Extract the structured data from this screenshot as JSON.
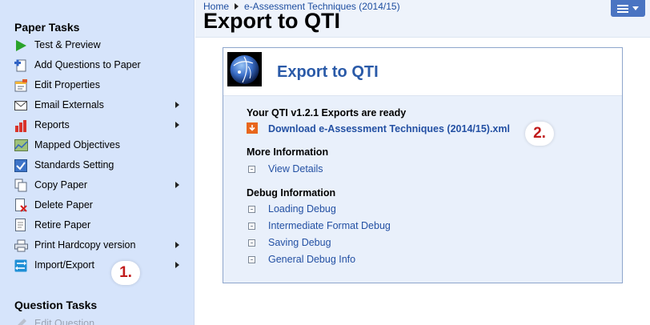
{
  "sidebar": {
    "paper_tasks_heading": "Paper Tasks",
    "items": [
      {
        "label": "Test & Preview",
        "icon": "play-icon",
        "submenu": false
      },
      {
        "label": "Add Questions to Paper",
        "icon": "add-document-icon",
        "submenu": false
      },
      {
        "label": "Edit Properties",
        "icon": "edit-properties-icon",
        "submenu": false
      },
      {
        "label": "Email Externals",
        "icon": "envelope-icon",
        "submenu": true
      },
      {
        "label": "Reports",
        "icon": "bar-chart-icon",
        "submenu": true
      },
      {
        "label": "Mapped Objectives",
        "icon": "objectives-icon",
        "submenu": false
      },
      {
        "label": "Standards Setting",
        "icon": "checkbox-icon",
        "submenu": false
      },
      {
        "label": "Copy Paper",
        "icon": "copy-icon",
        "submenu": true
      },
      {
        "label": "Delete Paper",
        "icon": "delete-document-icon",
        "submenu": false
      },
      {
        "label": "Retire Paper",
        "icon": "retire-icon",
        "submenu": false
      },
      {
        "label": "Print Hardcopy version",
        "icon": "printer-icon",
        "submenu": true
      },
      {
        "label": "Import/Export",
        "icon": "import-export-icon",
        "submenu": true
      }
    ],
    "question_tasks_heading": "Question Tasks",
    "question_items": [
      {
        "label": "Edit Question",
        "icon": "pencil-icon"
      }
    ]
  },
  "step_badges": {
    "one": "1.",
    "two": "2."
  },
  "header": {
    "breadcrumb": {
      "home": "Home",
      "current": "e-Assessment Techniques (2014/15)"
    },
    "title": "Export to QTI",
    "menu_icon": "hamburger-menu-icon"
  },
  "panel": {
    "title": "Export to QTI",
    "ready_heading": "Your QTI v1.2.1 Exports are ready",
    "download_label": "Download e-Assessment Techniques (2014/15).xml",
    "more_info_heading": "More Information",
    "more_info_links": [
      "View Details"
    ],
    "debug_heading": "Debug Information",
    "debug_links": [
      "Loading Debug",
      "Intermediate Format Debug",
      "Saving Debug",
      "General Debug Info"
    ]
  },
  "colors": {
    "sidebar_bg": "#d6e4fb",
    "link": "#2350a3",
    "panel_title": "#2a5aa8",
    "badge_text": "#c11b1b",
    "download_icon": "#e8661c"
  }
}
